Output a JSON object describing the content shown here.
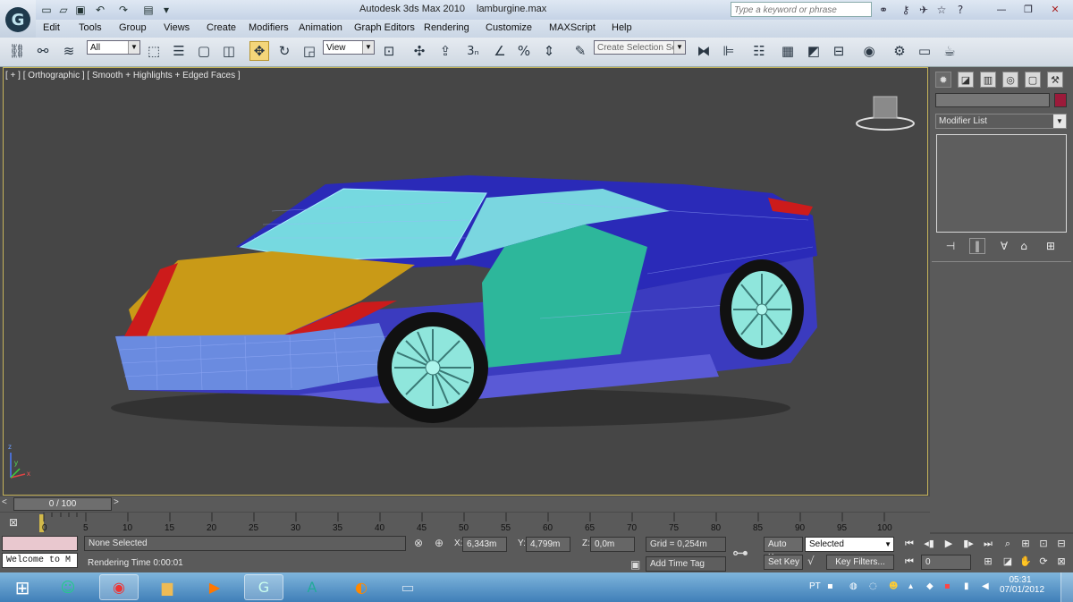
{
  "window": {
    "app_title": "Autodesk 3ds Max  2010",
    "file_name": "lamburgine.max"
  },
  "search": {
    "placeholder": "Type a keyword or phrase"
  },
  "menu": [
    "Edit",
    "Tools",
    "Group",
    "Views",
    "Create",
    "Modifiers",
    "Animation",
    "Graph Editors",
    "Rendering",
    "Customize",
    "MAXScript",
    "Help"
  ],
  "toolbar": {
    "selection_filter": "All",
    "ref_coord": "View",
    "create_selection_set": "Create Selection Se",
    "snap_3d": "3",
    "angle_snap_icon": "angle-snap-icon"
  },
  "viewport": {
    "label": "[ + ] [ Orthographic ] [ Smooth + Highlights + Edged Faces ]"
  },
  "command_panel": {
    "modifier_list": "Modifier List",
    "object_color": "#9c1a3a"
  },
  "timeline": {
    "frame_display": "0 / 100",
    "ticks": [
      "0",
      "5",
      "10",
      "15",
      "20",
      "25",
      "30",
      "35",
      "40",
      "45",
      "50",
      "55",
      "60",
      "65",
      "70",
      "75",
      "80",
      "85",
      "90",
      "95",
      "100"
    ]
  },
  "status": {
    "maxscript_listener": "Welcome to M",
    "selection": "None Selected",
    "prompt": "Rendering Time  0:00:01",
    "x_label": "X:",
    "x_value": "6,343m",
    "y_label": "Y:",
    "y_value": "4,799m",
    "z_label": "Z:",
    "z_value": "0,0m",
    "grid": "Grid = 0,254m",
    "add_time_tag": "Add Time Tag",
    "auto_key": "Auto Key",
    "set_key": "Set Key",
    "key_mode": "Selected",
    "key_filters": "Key Filters...",
    "current_frame": "0"
  },
  "taskbar": {
    "language": "PT",
    "time": "05:31",
    "date": "07/01/2012"
  }
}
